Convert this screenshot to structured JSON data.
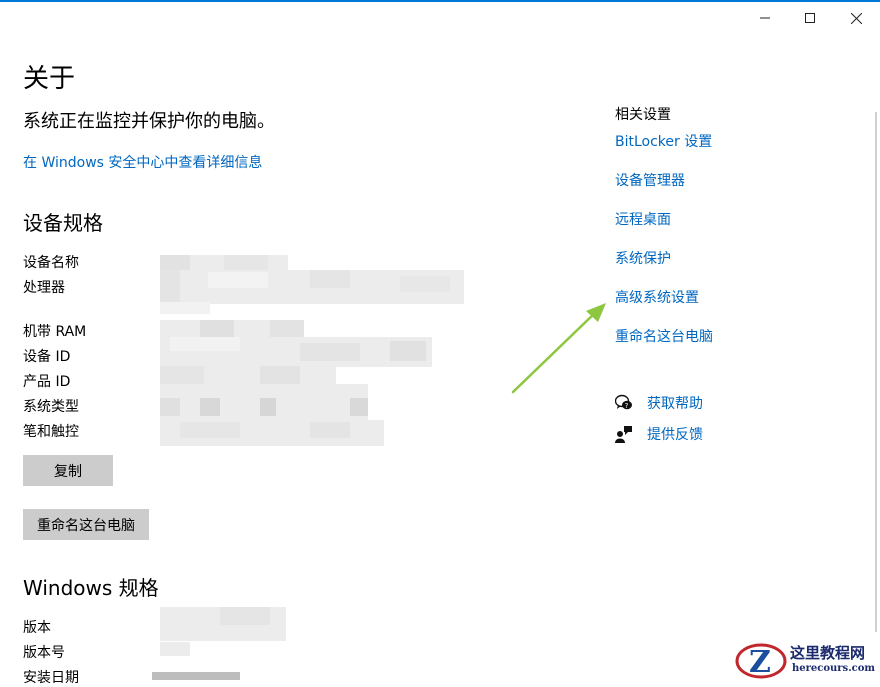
{
  "window": {
    "controls": [
      "minimize",
      "maximize",
      "close"
    ]
  },
  "page": {
    "title": "关于",
    "protection_status": "系统正在监控并保护你的电脑。",
    "security_link": "在 Windows 安全中心中查看详细信息"
  },
  "device_specs": {
    "heading": "设备规格",
    "labels": [
      "设备名称",
      "处理器",
      "机带 RAM",
      "设备 ID",
      "产品 ID",
      "系统类型",
      "笔和触控"
    ],
    "copy_button": "复制",
    "rename_button": "重命名这台电脑"
  },
  "windows_specs": {
    "heading": "Windows 规格",
    "labels": [
      "版本",
      "版本号",
      "安装日期"
    ]
  },
  "related": {
    "heading": "相关设置",
    "links": [
      "BitLocker 设置",
      "设备管理器",
      "远程桌面",
      "系统保护",
      "高级系统设置",
      "重命名这台电脑"
    ],
    "help": "获取帮助",
    "feedback": "提供反馈"
  },
  "annotation": {
    "arrow_color": "#8dc63f"
  },
  "watermark": {
    "title": "这里教程网",
    "url": "herecours.com"
  },
  "colors": {
    "accent": "#0067c0",
    "title_bar_line": "#0078d7",
    "button_bg": "#cccccc"
  }
}
